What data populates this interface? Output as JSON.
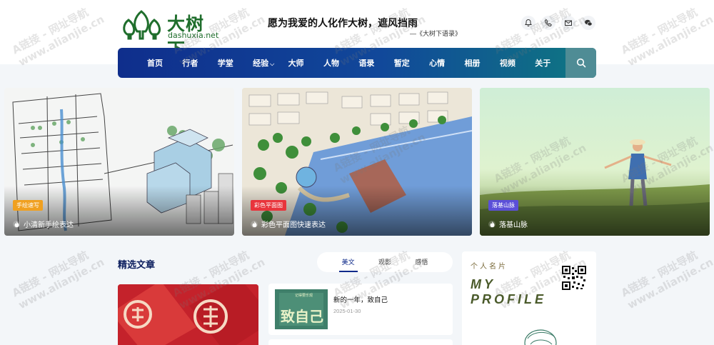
{
  "logo": {
    "cn": "大树下",
    "en": "dashuxia.net"
  },
  "slogan": {
    "text": "愿为我爱的人化作大树，遮风挡雨",
    "source": "—《大树下语录》"
  },
  "header_icons": [
    "bell-icon",
    "phone-icon",
    "mail-icon",
    "wechat-icon"
  ],
  "nav": {
    "items": [
      {
        "label": "首页"
      },
      {
        "label": "行者"
      },
      {
        "label": "学堂"
      },
      {
        "label": "经验",
        "has_dropdown": true
      },
      {
        "label": "大师"
      },
      {
        "label": "人物"
      },
      {
        "label": "语录"
      },
      {
        "label": "暂定"
      },
      {
        "label": "心情"
      },
      {
        "label": "相册"
      },
      {
        "label": "视频"
      },
      {
        "label": "关于"
      }
    ],
    "search_icon": "search-icon",
    "colors": {
      "start": "#0f2e8c",
      "end": "#0f7a84",
      "search_bg": "#4f8c95"
    }
  },
  "slides": [
    {
      "badge": "手绘速写",
      "badge_color": "#f0a020",
      "title": "小清新手绘表达"
    },
    {
      "badge": "彩色平面图",
      "badge_color": "#e8343c",
      "title": "彩色平面图快速表达"
    },
    {
      "badge": "落基山脉",
      "badge_color": "#5b4fd8",
      "title": "落基山脉"
    }
  ],
  "featured": {
    "title": "精选文章",
    "tabs": [
      {
        "label": "美文",
        "active": true
      },
      {
        "label": "观影"
      },
      {
        "label": "感悟"
      }
    ]
  },
  "post": {
    "thumb_title": "记得要乐观",
    "thumb_big": "致自己",
    "title": "新的一年，致自己",
    "date": "2025-01-30"
  },
  "profile": {
    "label": "个人名片",
    "my": "MY",
    "profile": "PROFILE"
  },
  "watermark": "A链接 - 网址导航\nwww.alianjie.cn"
}
